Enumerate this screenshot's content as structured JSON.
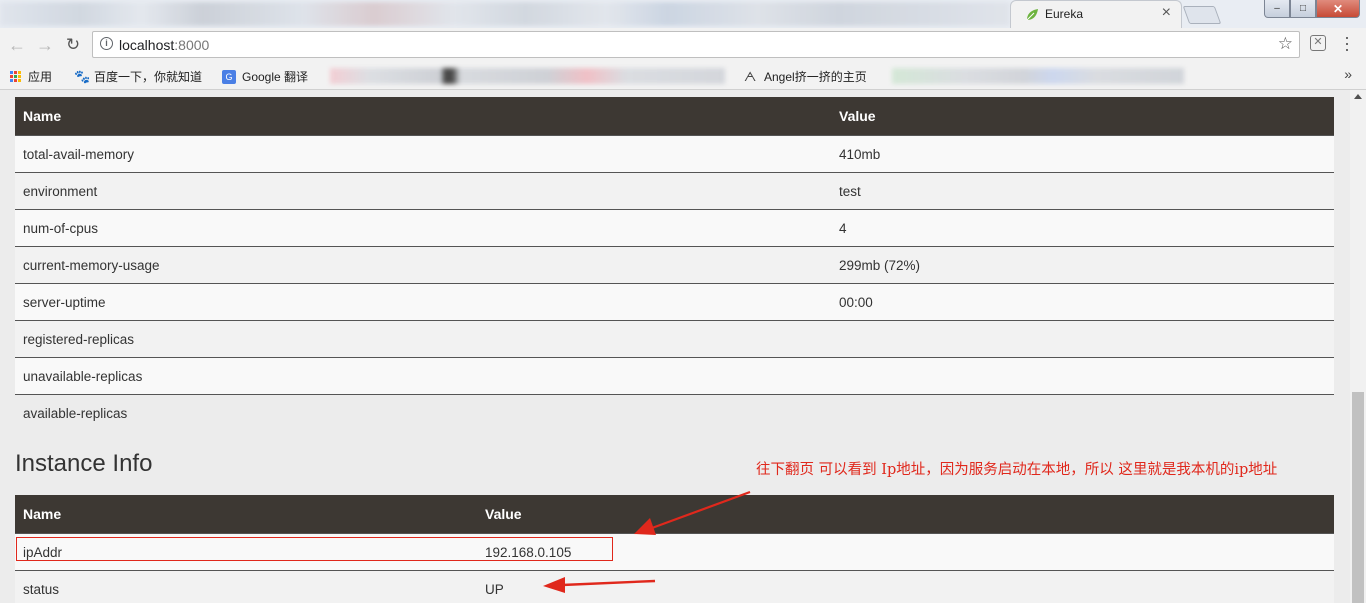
{
  "browser": {
    "active_tab": {
      "title": "Eureka",
      "close_label": "×"
    },
    "window_controls": {
      "minimize": "–",
      "maximize": "□",
      "close": "✕"
    },
    "address_bar": {
      "host": "localhost",
      "port": ":8000"
    },
    "bookmarks": [
      {
        "label": "应用",
        "icon": "apps-grid-icon"
      },
      {
        "label": "百度一下，你就知道",
        "icon": "baidu-icon"
      },
      {
        "label": "Google 翻译",
        "icon": "google-translate-icon"
      },
      {
        "label": "Angel挤一挤的主页",
        "icon": "angel-icon"
      }
    ],
    "bookmarks_overflow": "»"
  },
  "general_info": {
    "columns": [
      "Name",
      "Value"
    ],
    "rows": [
      {
        "name": "total-avail-memory",
        "value": "410mb"
      },
      {
        "name": "environment",
        "value": "test"
      },
      {
        "name": "num-of-cpus",
        "value": "4"
      },
      {
        "name": "current-memory-usage",
        "value": "299mb (72%)"
      },
      {
        "name": "server-uptime",
        "value": "00:00"
      },
      {
        "name": "registered-replicas",
        "value": ""
      },
      {
        "name": "unavailable-replicas",
        "value": ""
      },
      {
        "name": "available-replicas",
        "value": ""
      }
    ]
  },
  "instance_info": {
    "title": "Instance Info",
    "columns": [
      "Name",
      "Value"
    ],
    "rows": [
      {
        "name": "ipAddr",
        "value": "192.168.0.105"
      },
      {
        "name": "status",
        "value": "UP"
      }
    ]
  },
  "annotation": {
    "text": "往下翻页  可以看到 Ip地址，因为服务启动在本地，所以 这里就是我本机的ip地址",
    "color": "#e0281c"
  },
  "colors": {
    "table_header_bg": "#3d3833",
    "page_bg": "#ececec"
  }
}
